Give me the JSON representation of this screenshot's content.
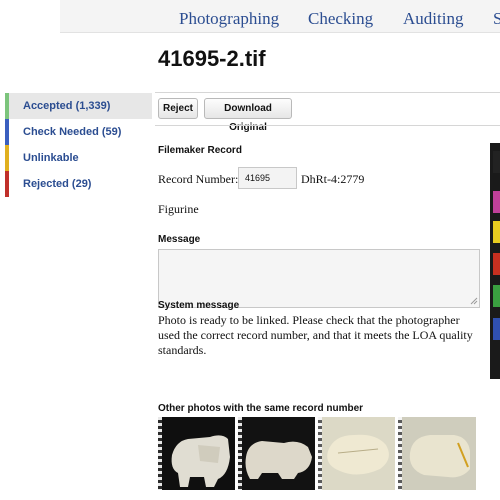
{
  "nav": {
    "items": [
      {
        "label": "Photographing"
      },
      {
        "label": "Checking"
      },
      {
        "label": "Auditing"
      },
      {
        "label": "S"
      }
    ]
  },
  "page": {
    "title": "41695-2.tif"
  },
  "sidebar": {
    "items": [
      {
        "label": "Accepted (1,339)",
        "color": "#7cc47c",
        "active": true
      },
      {
        "label": "Check Needed (59)",
        "color": "#3a5fbf",
        "active": false
      },
      {
        "label": "Unlinkable",
        "color": "#e0b020",
        "active": false
      },
      {
        "label": "Rejected (29)",
        "color": "#c0302a",
        "active": false
      }
    ]
  },
  "toolbar": {
    "reject_label": "Reject",
    "download_label": "Download Original"
  },
  "filemaker": {
    "heading": "Filemaker Record",
    "record_label": "Record Number:",
    "record_value": "41695",
    "record_code": "DhRt-4:2779",
    "object_name": "Figurine"
  },
  "message": {
    "heading": "Message",
    "value": ""
  },
  "system_message": {
    "heading": "System message",
    "text": "Photo is ready to be linked. Please check that the photographer used the correct record number, and that it meets the LOA quality standards."
  },
  "other_photos": {
    "heading": "Other photos with the same record number"
  },
  "colors": {
    "link": "#2b4d91",
    "chart_swatches": [
      "#222222",
      "#c0409a",
      "#e8cc20",
      "#c83020",
      "#3aa040",
      "#3050b0"
    ]
  }
}
